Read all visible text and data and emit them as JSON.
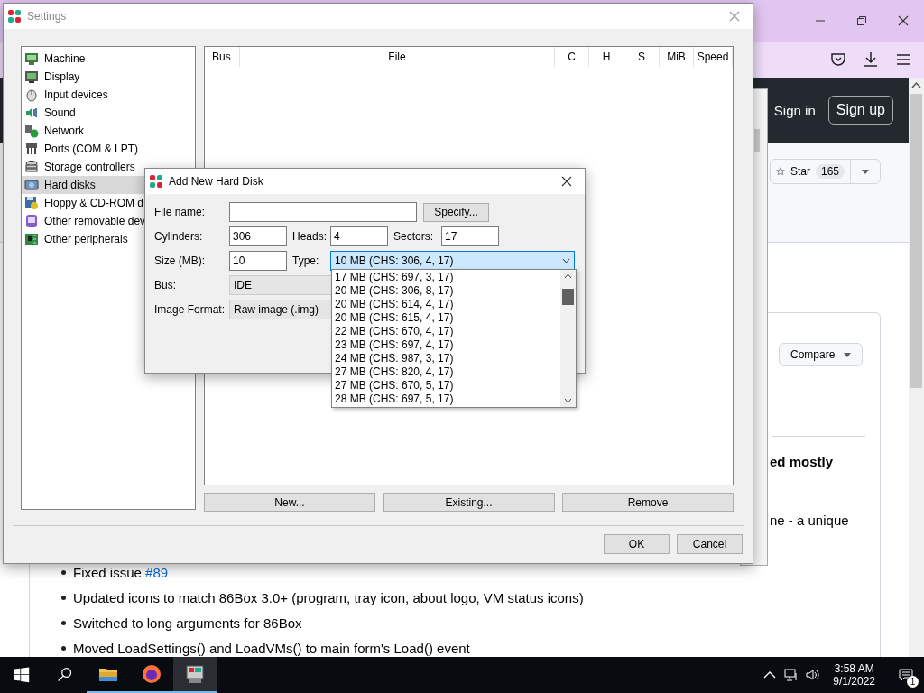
{
  "browser": {
    "header_links": [
      {
        "kind": "link",
        "label": "Sign in"
      },
      {
        "kind": "button",
        "label": "Sign up"
      }
    ],
    "star": {
      "label": "Star",
      "count": "165"
    },
    "compare": "Compare",
    "fragments": [
      {
        "kind": "heading",
        "text": "ed mostly"
      },
      {
        "kind": "text",
        "text": "ne - a unique"
      }
    ],
    "bullets": [
      {
        "text": "Fixed issue ",
        "link": "#89"
      },
      {
        "text": "Updated icons to match 86Box 3.0+ (program, tray icon, about logo, VM status icons)"
      },
      {
        "text": "Switched to long arguments for 86Box"
      },
      {
        "text": "Moved LoadSettings() and LoadVMs() to main form's Load() event"
      }
    ]
  },
  "settings": {
    "title": "Settings",
    "categories": [
      {
        "label": "Machine",
        "selected": false
      },
      {
        "label": "Display",
        "selected": false
      },
      {
        "label": "Input devices",
        "selected": false
      },
      {
        "label": "Sound",
        "selected": false
      },
      {
        "label": "Network",
        "selected": false
      },
      {
        "label": "Ports (COM & LPT)",
        "selected": false
      },
      {
        "label": "Storage controllers",
        "selected": false
      },
      {
        "label": "Hard disks",
        "selected": true
      },
      {
        "label": "Floppy & CD-ROM d",
        "selected": false
      },
      {
        "label": "Other removable dev",
        "selected": false
      },
      {
        "label": "Other peripherals",
        "selected": false
      }
    ],
    "disk_table": {
      "columns": [
        "Bus",
        "File",
        "C",
        "H",
        "S",
        "MiB",
        "Speed"
      ]
    },
    "buttons": [
      "New...",
      "Existing...",
      "Remove"
    ],
    "footer_buttons": [
      "OK",
      "Cancel"
    ]
  },
  "dialog": {
    "title": "Add New Hard Disk",
    "file_name": {
      "label": "File name:"
    },
    "specify_button": "Specify...",
    "cylinders": {
      "label": "Cylinders:",
      "value": "306"
    },
    "heads": {
      "label": "Heads:",
      "value": "4"
    },
    "sectors": {
      "label": "Sectors:",
      "value": "17"
    },
    "size": {
      "label": "Size (MB):",
      "value": "10"
    },
    "type": {
      "label": "Type:",
      "value": "10 MB (CHS: 306, 4, 17)",
      "expanded": true,
      "options": [
        "17 MB (CHS: 697, 3, 17)",
        "20 MB (CHS: 306, 8, 17)",
        "20 MB (CHS: 614, 4, 17)",
        "20 MB (CHS: 615, 4, 17)",
        "22 MB (CHS: 670, 4, 17)",
        "23 MB (CHS: 697, 4, 17)",
        "24 MB (CHS: 987, 3, 17)",
        "27 MB (CHS: 820, 4, 17)",
        "27 MB (CHS: 670, 5, 17)",
        "28 MB (CHS: 697, 5, 17)"
      ]
    },
    "bus": {
      "label": "Bus:",
      "value": "IDE"
    },
    "image_format": {
      "label": "Image Format:",
      "value": "Raw image (.img)"
    }
  },
  "taskbar": {
    "apps": [
      {
        "selected": false
      },
      {
        "selected": false
      },
      {
        "selected": true
      }
    ],
    "time": "3:58 AM",
    "date": "9/1/2022",
    "notifications": "1"
  }
}
